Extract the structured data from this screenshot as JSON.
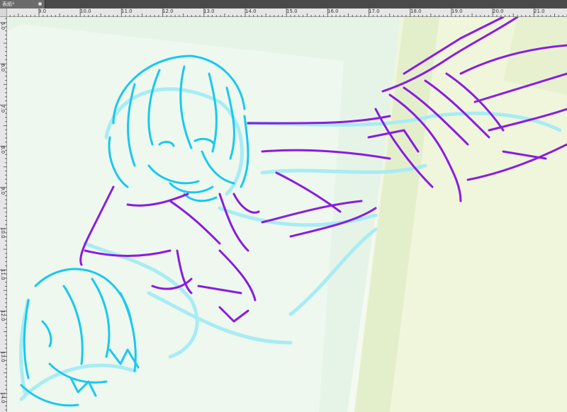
{
  "document_tab": {
    "title": "表紙*",
    "close_icon": "close-icon"
  },
  "ruler_top": {
    "labels": [
      "9.0",
      "10.0",
      "11.0",
      "12.0",
      "13.0",
      "14.0",
      "15.0",
      "16.0",
      "17.0",
      "18.0",
      "19.0",
      "20.0",
      "21.0"
    ]
  },
  "ruler_left": {
    "labels": [
      "5.0",
      "6.0",
      "7.0",
      "8.0",
      "9.0",
      "10.0",
      "11.0",
      "12.0",
      "13.0",
      "14.0"
    ]
  },
  "colors": {
    "sketch_cyan": "#19c8f0",
    "sketch_purple": "#8a1be0",
    "sketch_light_cyan": "#a8ecf4",
    "bg_green_tint": "#dff2e2",
    "bg_yellow_tint": "#eef5d6"
  }
}
